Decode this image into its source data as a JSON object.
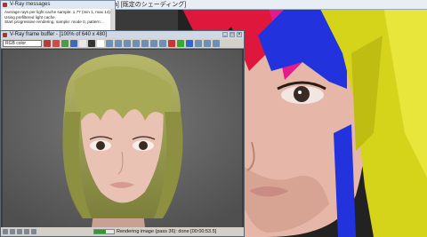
{
  "viewport": {
    "title": "a] [既定のシェーディング]"
  },
  "messages_window": {
    "title": "V-Ray messages",
    "lines": [
      "Average rays per light cache sample: 1.77 (min 1, max 14)",
      "Using prefiltered light cache.",
      "Start progressive rendering, sample: mode 0, pattern: .."
    ]
  },
  "framebuffer": {
    "title": "V-Ray frame buffer - [100% of 640 x 480]",
    "channel": "RGB color",
    "status": "Rendering image (pass 36): done [00:00:53.5]",
    "progress": 0.6,
    "toolbar_colors": [
      "#b04040",
      "#c94d4d",
      "#4d9a4d",
      "#4466bb",
      "#e8e8e8",
      "#333333",
      "#ffffff",
      "#6f8fb4",
      "#6f8fb4",
      "#6f8fb4",
      "#6f8fb4",
      "#6f8fb4",
      "#6f8fb4",
      "#6f8fb4",
      "#cc3333",
      "#33aa33",
      "#3366cc",
      "#6f8fb4",
      "#6f8fb4",
      "#6f8fb4"
    ]
  }
}
